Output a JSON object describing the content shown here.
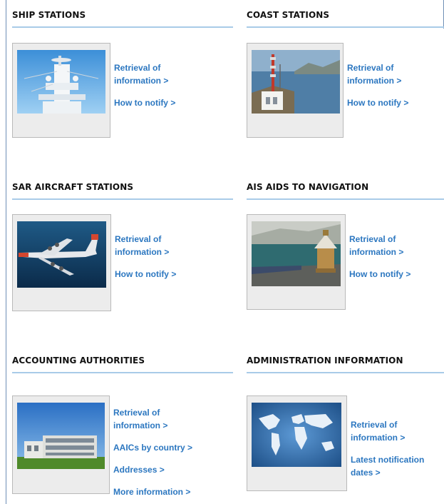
{
  "sections": {
    "ship": {
      "title": "SHIP STATIONS",
      "links": {
        "retrieval_1": "Retrieval of",
        "retrieval_2": "information >",
        "notify": "How to notify >"
      }
    },
    "coast": {
      "title": "COAST STATIONS",
      "links": {
        "retrieval_1": "Retrieval of",
        "retrieval_2": "information >",
        "notify": "How to notify >"
      }
    },
    "sar": {
      "title": "SAR AIRCRAFT STATIONS",
      "links": {
        "retrieval_1": "Retrieval of",
        "retrieval_2": "information >",
        "notify": "How to notify >"
      }
    },
    "ais": {
      "title": "AIS AIDS TO NAVIGATION",
      "links": {
        "retrieval_1": "Retrieval of",
        "retrieval_2": "information >",
        "notify": "How to notify >"
      }
    },
    "accounting": {
      "title": "ACCOUNTING AUTHORITIES",
      "links": {
        "retrieval_1": "Retrieval of",
        "retrieval_2": "information >",
        "aaics": "AAICs by country >",
        "addresses": "Addresses >",
        "more": "More information >"
      }
    },
    "admin": {
      "title": "ADMINISTRATION INFORMATION",
      "links": {
        "retrieval_1": "Retrieval of",
        "retrieval_2": "information >",
        "latest_1": "Latest notification",
        "latest_2": "dates >"
      }
    }
  },
  "colors": {
    "link": "#2c77c0",
    "rule": "#a9cbe8",
    "border": "#6f8fb6"
  }
}
